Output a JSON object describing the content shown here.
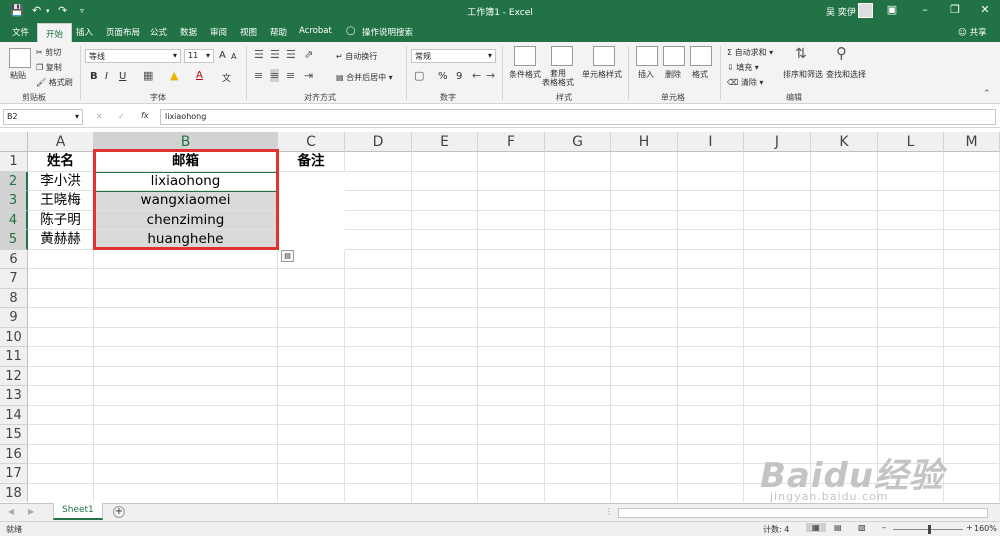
{
  "window": {
    "title": "工作簿1 - Excel",
    "user": "吴 奕伊",
    "share": "共享"
  },
  "tabs": [
    "文件",
    "开始",
    "插入",
    "页面布局",
    "公式",
    "数据",
    "审阅",
    "视图",
    "帮助",
    "Acrobat",
    "操作说明搜索"
  ],
  "ribbon": {
    "clipboard": {
      "paste": "粘贴",
      "cut": "剪切",
      "copy": "复制",
      "format_painter": "格式刷",
      "label": "剪贴板"
    },
    "font": {
      "name": "等线",
      "size": "11",
      "bold": "B",
      "italic": "I",
      "underline": "U",
      "grow": "A",
      "shrink": "A",
      "font_color": "A",
      "phonetic": "文",
      "label": "字体"
    },
    "alignment": {
      "wrap": "自动换行",
      "merge": "合并后居中",
      "label": "对齐方式"
    },
    "number": {
      "format": "常规",
      "percent": "%",
      "comma": "9",
      "label": "数字"
    },
    "styles": {
      "conditional": "条件格式",
      "table": "套用\n表格格式",
      "cell_styles": "单元格样式",
      "label": "样式"
    },
    "cells": {
      "insert": "插入",
      "delete": "删除",
      "format": "格式",
      "label": "单元格"
    },
    "editing": {
      "autosum": "自动求和",
      "fill": "填充",
      "clear": "清除",
      "sort": "排序和筛选",
      "find": "查找和选择",
      "label": "编辑"
    }
  },
  "formula_bar": {
    "name_box": "B2",
    "fx": "fx",
    "value": "lixiaohong"
  },
  "columns": [
    "A",
    "B",
    "C",
    "D",
    "E",
    "F",
    "G",
    "H",
    "I",
    "J",
    "K",
    "L",
    "M"
  ],
  "rows": [
    "1",
    "2",
    "3",
    "4",
    "5",
    "6",
    "7",
    "8",
    "9",
    "10",
    "11",
    "12",
    "13",
    "14",
    "15",
    "16",
    "17",
    "18"
  ],
  "cells": {
    "A1": "姓名",
    "B1": "邮箱",
    "C1": "备注",
    "A2": "李小洪",
    "B2": "lixiaohong",
    "A3": "王晓梅",
    "B3": "wangxiaomei",
    "A4": "陈子明",
    "B4": "chenziming",
    "A5": "黄赫赫",
    "B5": "huanghehe"
  },
  "sheet": {
    "name": "Sheet1",
    "add": "+"
  },
  "status": {
    "ready": "就绪",
    "count": "计数: 4",
    "zoom": "160%"
  },
  "watermark": {
    "main": "Baidu经验",
    "sub": "jingyan.baidu.com"
  },
  "colors": {
    "excel_green": "#217346",
    "selection_red": "#e0322f",
    "shade": "#d9d9d9"
  }
}
